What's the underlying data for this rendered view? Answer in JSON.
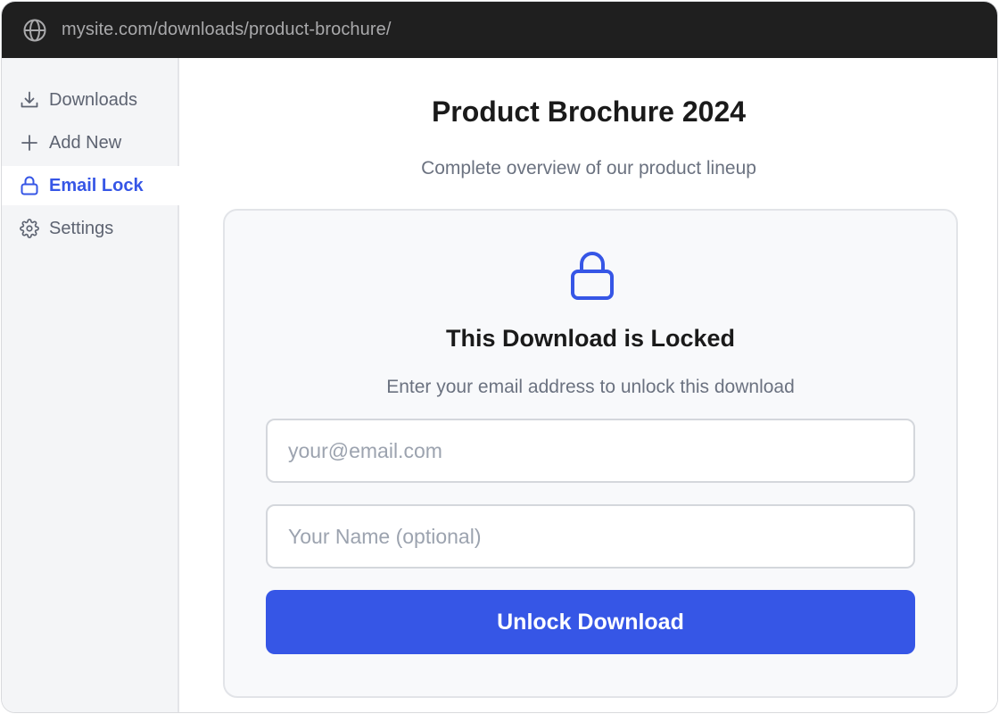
{
  "browser": {
    "url": "mysite.com/downloads/product-brochure/",
    "icon": "globe-icon"
  },
  "sidebar": {
    "items": [
      {
        "label": "Downloads",
        "icon": "download-icon",
        "active": false
      },
      {
        "label": "Add New",
        "icon": "plus-icon",
        "active": false
      },
      {
        "label": "Email Lock",
        "icon": "lock-icon",
        "active": true
      },
      {
        "label": "Settings",
        "icon": "gear-icon",
        "active": false
      }
    ]
  },
  "main": {
    "title": "Product Brochure 2024",
    "subtitle": "Complete overview of our product lineup",
    "card": {
      "icon": "lock-icon",
      "title": "This Download is Locked",
      "description": "Enter your email address to unlock this download",
      "email_placeholder": "your@email.com",
      "email_value": "",
      "name_placeholder": "Your Name (optional)",
      "name_value": "",
      "button_label": "Unlock Download"
    }
  },
  "colors": {
    "accent": "#3656e6",
    "urlbar_bg": "#1f1f1f",
    "sidebar_bg": "#f4f5f7",
    "card_bg": "#f8f9fb",
    "text_muted": "#6b7280"
  }
}
